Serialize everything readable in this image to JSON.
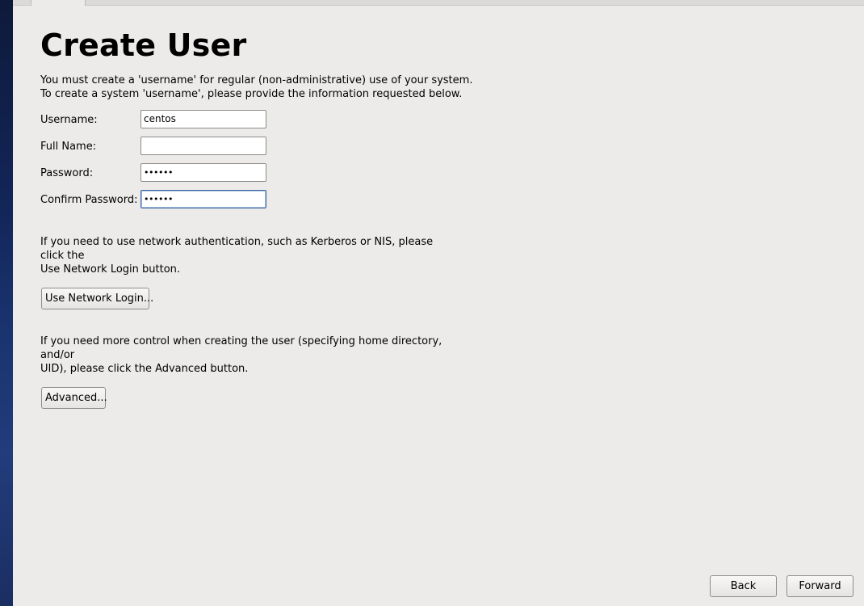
{
  "page": {
    "title": "Create User",
    "intro_line1": "You must create a 'username' for regular (non-administrative) use of your system.",
    "intro_line2": "To create a system 'username', please provide the information requested below."
  },
  "form": {
    "username_label": "Username:",
    "username_value": "centos",
    "fullname_label": "Full Name:",
    "fullname_value": "",
    "password_label": "Password:",
    "password_value": "••••••",
    "confirm_label": "Confirm Password:",
    "confirm_value": "••••••"
  },
  "network": {
    "line1": "If you need to use network authentication, such as Kerberos or NIS, please click the",
    "line2": "Use Network Login button.",
    "button_label": "Use Network Login..."
  },
  "advanced": {
    "line1": "If you need more control when creating the user (specifying home directory, and/or",
    "line2": "UID), please click the Advanced button.",
    "button_label": "Advanced..."
  },
  "nav": {
    "back_label": "Back",
    "forward_label": "Forward"
  }
}
